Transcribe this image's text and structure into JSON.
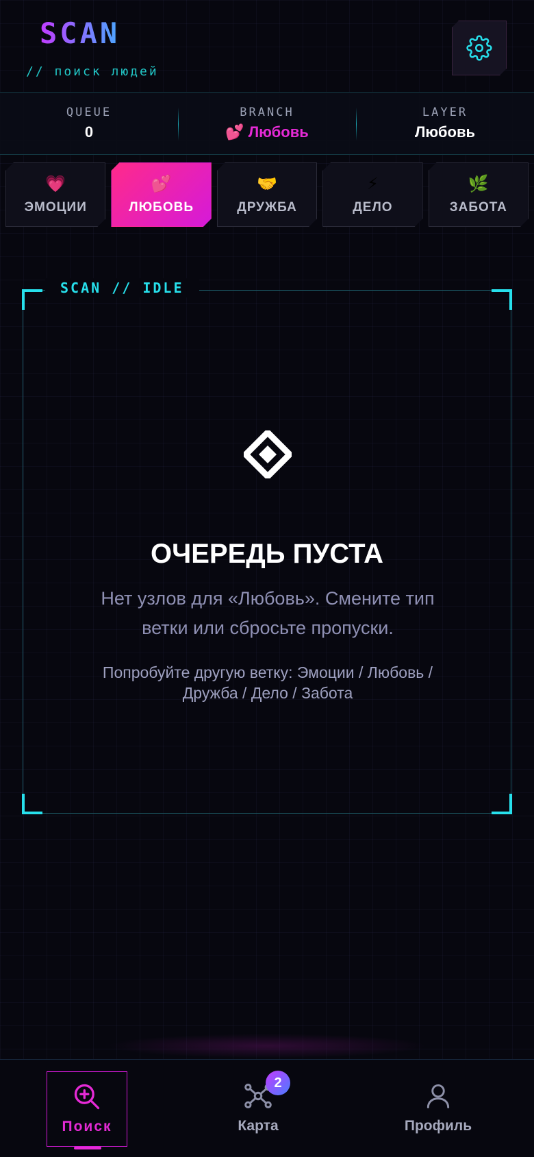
{
  "header": {
    "logo": "SCAN",
    "tagline": "// поиск людей",
    "settings_icon": "gear-icon"
  },
  "stats": {
    "queue": {
      "label": "QUEUE",
      "value": "0"
    },
    "branch": {
      "label": "BRANCH",
      "value": "Любовь",
      "icon": "💕"
    },
    "layer": {
      "label": "LAYER",
      "value": "Любовь"
    }
  },
  "tabs": [
    {
      "label": "ЭМОЦИИ",
      "icon": "💗",
      "active": false
    },
    {
      "label": "ЛЮБОВЬ",
      "icon": "💕",
      "active": true
    },
    {
      "label": "ДРУЖБА",
      "icon": "🤝",
      "active": false
    },
    {
      "label": "ДЕЛО",
      "icon": "⚡",
      "active": false
    },
    {
      "label": "ЗАБОТА",
      "icon": "🌿",
      "active": false
    }
  ],
  "scan": {
    "status": "SCAN // IDLE",
    "empty_title": "ОЧЕРЕДЬ ПУСТА",
    "empty_desc": "Нет узлов для «Любовь». Смените тип ветки или сбросьте пропуски.",
    "empty_hint": "Попробуйте другую ветку: Эмоции / Любовь / Дружба / Дело / Забота"
  },
  "nav": {
    "search": {
      "label": "Поиск",
      "active": true
    },
    "map": {
      "label": "Карта",
      "badge": "2"
    },
    "profile": {
      "label": "Профиль"
    }
  },
  "colors": {
    "accent_cyan": "#27e0ec",
    "accent_pink": "#e62ad6",
    "background": "#07070f"
  }
}
